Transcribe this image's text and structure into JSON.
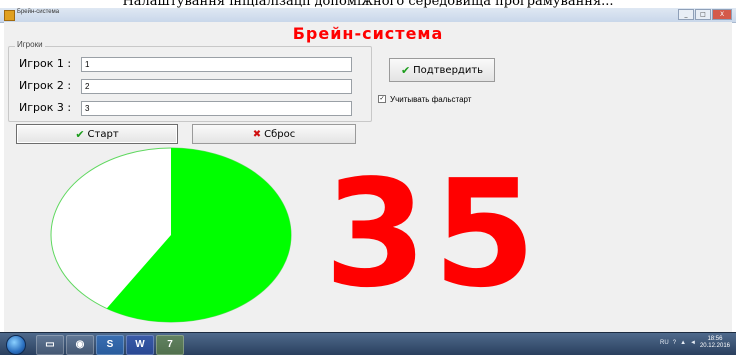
{
  "caption": "Налаштування ініціалізації допоміжного середовища програмування...",
  "window": {
    "title": "Брейн-система",
    "min_label": "_",
    "max_label": "□",
    "close_label": "X"
  },
  "app": {
    "title": "Брейн-система",
    "group_label": "Игроки",
    "players": [
      {
        "label": "Игрок 1 :",
        "value": "1"
      },
      {
        "label": "Игрок 2 :",
        "value": "2"
      },
      {
        "label": "Игрок 3 :",
        "value": "3"
      }
    ],
    "confirm_label": "Подтвердить",
    "confirm_icon": "check-icon",
    "false_start_label": "Учитывать фальстарт",
    "false_start_checked": true,
    "start_label": "Старт",
    "reset_label": "Сброс",
    "score": "35",
    "timer_fraction_elapsed": 0.41,
    "colors": {
      "accent": "#ff0000",
      "pie_fill": "#00ff00",
      "pie_empty": "#ffffff",
      "check": "#1a9c1a"
    }
  },
  "taskbar": {
    "items": [
      "S",
      "W",
      "7"
    ],
    "tray_language": "RU",
    "clock_time": "18:56",
    "clock_date": "20.12.2016"
  }
}
